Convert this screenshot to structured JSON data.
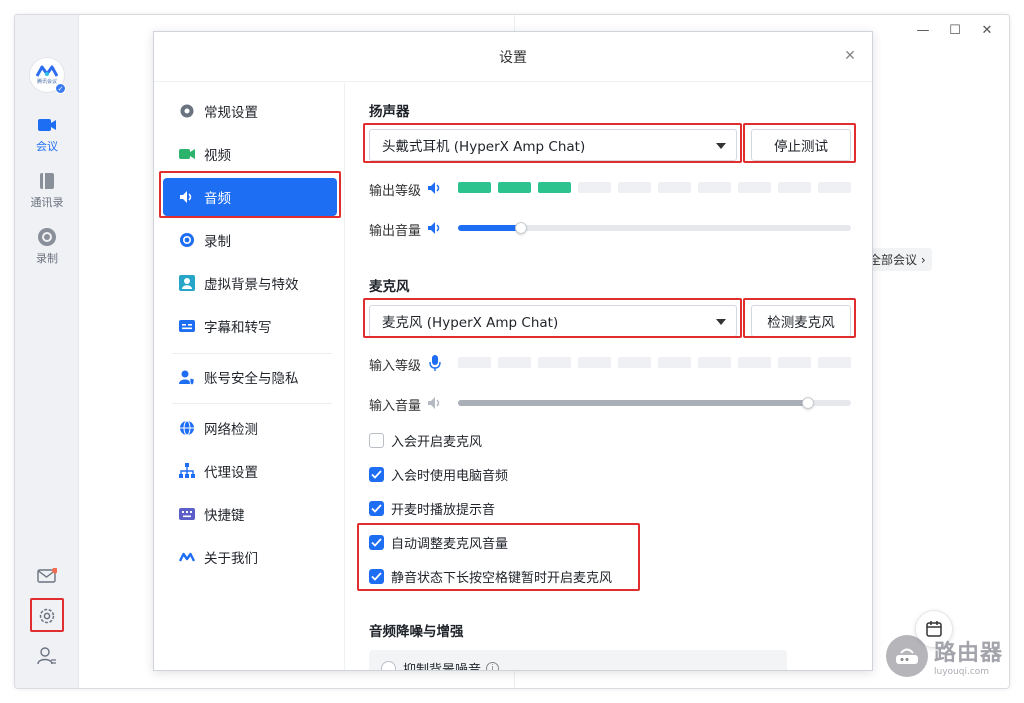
{
  "left_nav": {
    "logo_text": "腾讯会议",
    "items": [
      {
        "label": "会议",
        "icon": "video-camera-icon"
      },
      {
        "label": "通讯录",
        "icon": "contacts-book-icon"
      },
      {
        "label": "录制",
        "icon": "record-icon"
      }
    ],
    "bottom_icons": [
      "mail-icon",
      "gear-icon",
      "user-switch-icon"
    ]
  },
  "background": {
    "all_meetings": "全部会议 ›"
  },
  "watermark": {
    "text": "路由器",
    "sub": "luyouqi.com"
  },
  "dialog": {
    "title": "设置",
    "sidebar": [
      {
        "label": "常规设置",
        "icon": "gear-icon"
      },
      {
        "label": "视频",
        "icon": "video-icon"
      },
      {
        "label": "音频",
        "icon": "speaker-icon"
      },
      {
        "label": "录制",
        "icon": "record-icon"
      },
      {
        "label": "虚拟背景与特效",
        "icon": "portrait-icon"
      },
      {
        "label": "字幕和转写",
        "icon": "caption-icon"
      },
      {
        "label": "账号安全与隐私",
        "icon": "account-shield-icon"
      },
      {
        "label": "网络检测",
        "icon": "globe-icon"
      },
      {
        "label": "代理设置",
        "icon": "network-tree-icon"
      },
      {
        "label": "快捷键",
        "icon": "keyboard-icon"
      },
      {
        "label": "关于我们",
        "icon": "tencent-logo-icon"
      }
    ],
    "speaker": {
      "title": "扬声器",
      "device": "头戴式耳机 (HyperX Amp Chat)",
      "test_button": "停止测试",
      "output_level_label": "输出等级",
      "output_level": 0.3,
      "output_volume_label": "输出音量",
      "output_volume": 0.16
    },
    "microphone": {
      "title": "麦克风",
      "device": "麦克风 (HyperX Amp Chat)",
      "test_button": "检测麦克风",
      "input_level_label": "输入等级",
      "input_level": 0,
      "input_volume_label": "输入音量",
      "input_volume": 0.89
    },
    "options": [
      {
        "label": "入会开启麦克风",
        "checked": false
      },
      {
        "label": "入会时使用电脑音频",
        "checked": true
      },
      {
        "label": "开麦时播放提示音",
        "checked": true
      },
      {
        "label": "自动调整麦克风音量",
        "checked": true
      },
      {
        "label": "静音状态下长按空格键暂时开启麦克风",
        "checked": true
      }
    ],
    "noise": {
      "title": "音频降噪与增强",
      "option": "抑制背景噪音"
    }
  },
  "colors": {
    "accent": "#1e6ef4",
    "level_on": "#2dc38f",
    "highlight": "#e02d2d"
  }
}
